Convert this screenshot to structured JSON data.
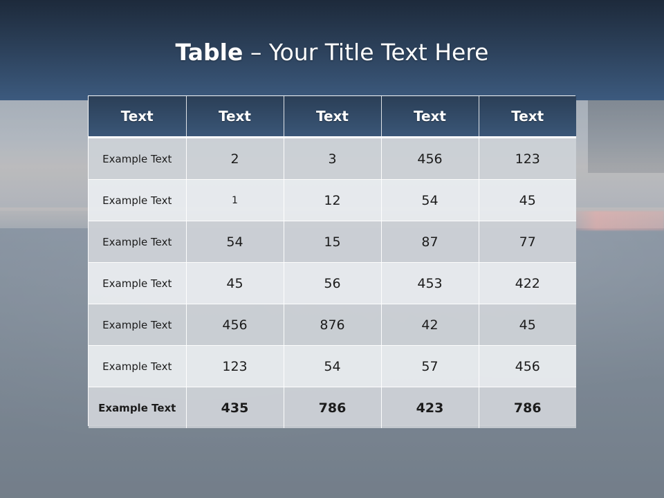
{
  "slide": {
    "title_bold": "Table",
    "title_rest": " – Your Title Text Here",
    "colors": {
      "header_band_top": "#1d2a3b",
      "header_band_bottom": "#3c5a7e",
      "table_header": "#2f4663",
      "row_odd": "#cacdd4",
      "row_even": "#e7eaee"
    }
  },
  "table": {
    "headers": [
      "Text",
      "Text",
      "Text",
      "Text",
      "Text"
    ],
    "rows": [
      {
        "label": "Example Text",
        "values": [
          "2",
          "3",
          "456",
          "123"
        ]
      },
      {
        "label": "Example Text",
        "values": [
          "1",
          "12",
          "54",
          "45"
        ]
      },
      {
        "label": "Example Text",
        "values": [
          "54",
          "15",
          "87",
          "77"
        ]
      },
      {
        "label": "Example Text",
        "values": [
          "45",
          "56",
          "453",
          "422"
        ]
      },
      {
        "label": "Example Text",
        "values": [
          "456",
          "876",
          "42",
          "45"
        ]
      },
      {
        "label": "Example Text",
        "values": [
          "123",
          "54",
          "57",
          "456"
        ]
      },
      {
        "label": "Example Text",
        "values": [
          "435",
          "786",
          "423",
          "786"
        ]
      }
    ]
  }
}
